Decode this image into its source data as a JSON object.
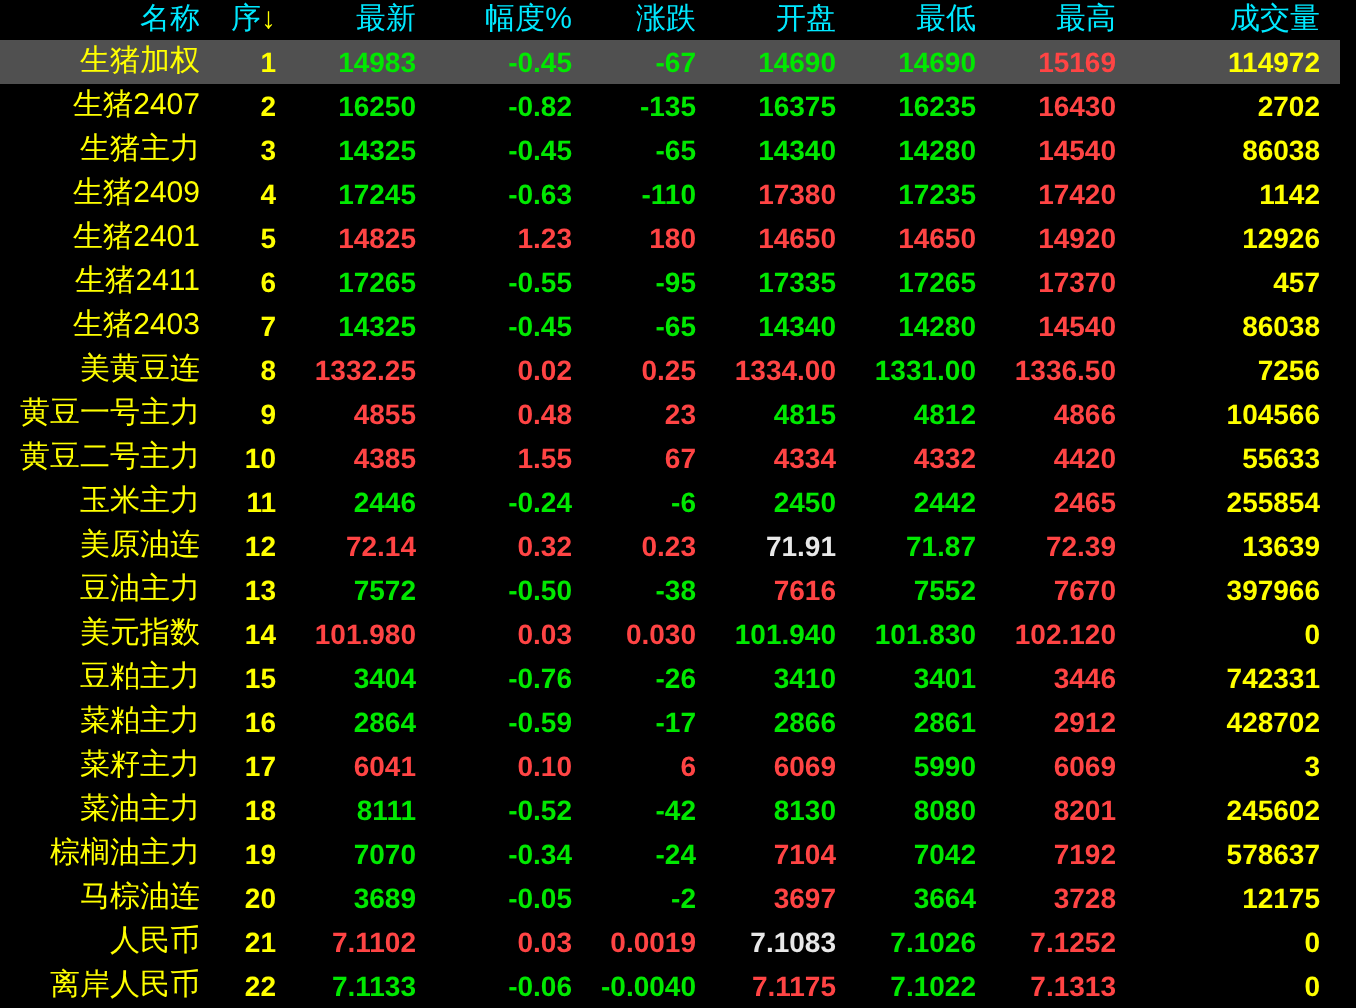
{
  "columns": [
    {
      "label": "名称"
    },
    {
      "label": "序",
      "sort_arrow": "↓"
    },
    {
      "label": "最新"
    },
    {
      "label": "幅度%"
    },
    {
      "label": "涨跌"
    },
    {
      "label": "开盘"
    },
    {
      "label": "最低"
    },
    {
      "label": "最高"
    },
    {
      "label": "成交量"
    }
  ],
  "rows": [
    {
      "name": "生猪加权",
      "index": "1",
      "selected": true,
      "cells": [
        {
          "text": "14983",
          "color": "#00e800"
        },
        {
          "text": "-0.45",
          "color": "#00e800"
        },
        {
          "text": "-67",
          "color": "#00e800"
        },
        {
          "text": "14690",
          "color": "#00e800"
        },
        {
          "text": "14690",
          "color": "#00e800"
        },
        {
          "text": "15169",
          "color": "#ff4444"
        }
      ],
      "volume": "114972"
    },
    {
      "name": "生猪2407",
      "index": "2",
      "selected": false,
      "cells": [
        {
          "text": "16250",
          "color": "#00e800"
        },
        {
          "text": "-0.82",
          "color": "#00e800"
        },
        {
          "text": "-135",
          "color": "#00e800"
        },
        {
          "text": "16375",
          "color": "#00e800"
        },
        {
          "text": "16235",
          "color": "#00e800"
        },
        {
          "text": "16430",
          "color": "#ff4444"
        }
      ],
      "volume": "2702"
    },
    {
      "name": "生猪主力",
      "index": "3",
      "selected": false,
      "cells": [
        {
          "text": "14325",
          "color": "#00e800"
        },
        {
          "text": "-0.45",
          "color": "#00e800"
        },
        {
          "text": "-65",
          "color": "#00e800"
        },
        {
          "text": "14340",
          "color": "#00e800"
        },
        {
          "text": "14280",
          "color": "#00e800"
        },
        {
          "text": "14540",
          "color": "#ff4444"
        }
      ],
      "volume": "86038"
    },
    {
      "name": "生猪2409",
      "index": "4",
      "selected": false,
      "cells": [
        {
          "text": "17245",
          "color": "#00e800"
        },
        {
          "text": "-0.63",
          "color": "#00e800"
        },
        {
          "text": "-110",
          "color": "#00e800"
        },
        {
          "text": "17380",
          "color": "#ff4444"
        },
        {
          "text": "17235",
          "color": "#00e800"
        },
        {
          "text": "17420",
          "color": "#ff4444"
        }
      ],
      "volume": "1142"
    },
    {
      "name": "生猪2401",
      "index": "5",
      "selected": false,
      "cells": [
        {
          "text": "14825",
          "color": "#ff4444"
        },
        {
          "text": "1.23",
          "color": "#ff4444"
        },
        {
          "text": "180",
          "color": "#ff4444"
        },
        {
          "text": "14650",
          "color": "#ff4444"
        },
        {
          "text": "14650",
          "color": "#ff4444"
        },
        {
          "text": "14920",
          "color": "#ff4444"
        }
      ],
      "volume": "12926"
    },
    {
      "name": "生猪2411",
      "index": "6",
      "selected": false,
      "cells": [
        {
          "text": "17265",
          "color": "#00e800"
        },
        {
          "text": "-0.55",
          "color": "#00e800"
        },
        {
          "text": "-95",
          "color": "#00e800"
        },
        {
          "text": "17335",
          "color": "#00e800"
        },
        {
          "text": "17265",
          "color": "#00e800"
        },
        {
          "text": "17370",
          "color": "#ff4444"
        }
      ],
      "volume": "457"
    },
    {
      "name": "生猪2403",
      "index": "7",
      "selected": false,
      "cells": [
        {
          "text": "14325",
          "color": "#00e800"
        },
        {
          "text": "-0.45",
          "color": "#00e800"
        },
        {
          "text": "-65",
          "color": "#00e800"
        },
        {
          "text": "14340",
          "color": "#00e800"
        },
        {
          "text": "14280",
          "color": "#00e800"
        },
        {
          "text": "14540",
          "color": "#ff4444"
        }
      ],
      "volume": "86038"
    },
    {
      "name": "美黄豆连",
      "index": "8",
      "selected": false,
      "cells": [
        {
          "text": "1332.25",
          "color": "#ff4444"
        },
        {
          "text": "0.02",
          "color": "#ff4444"
        },
        {
          "text": "0.25",
          "color": "#ff4444"
        },
        {
          "text": "1334.00",
          "color": "#ff4444"
        },
        {
          "text": "1331.00",
          "color": "#00e800"
        },
        {
          "text": "1336.50",
          "color": "#ff4444"
        }
      ],
      "volume": "7256"
    },
    {
      "name": "黄豆一号主力",
      "index": "9",
      "selected": false,
      "cells": [
        {
          "text": "4855",
          "color": "#ff4444"
        },
        {
          "text": "0.48",
          "color": "#ff4444"
        },
        {
          "text": "23",
          "color": "#ff4444"
        },
        {
          "text": "4815",
          "color": "#00e800"
        },
        {
          "text": "4812",
          "color": "#00e800"
        },
        {
          "text": "4866",
          "color": "#ff4444"
        }
      ],
      "volume": "104566"
    },
    {
      "name": "黄豆二号主力",
      "index": "10",
      "selected": false,
      "cells": [
        {
          "text": "4385",
          "color": "#ff4444"
        },
        {
          "text": "1.55",
          "color": "#ff4444"
        },
        {
          "text": "67",
          "color": "#ff4444"
        },
        {
          "text": "4334",
          "color": "#ff4444"
        },
        {
          "text": "4332",
          "color": "#ff4444"
        },
        {
          "text": "4420",
          "color": "#ff4444"
        }
      ],
      "volume": "55633"
    },
    {
      "name": "玉米主力",
      "index": "11",
      "selected": false,
      "cells": [
        {
          "text": "2446",
          "color": "#00e800"
        },
        {
          "text": "-0.24",
          "color": "#00e800"
        },
        {
          "text": "-6",
          "color": "#00e800"
        },
        {
          "text": "2450",
          "color": "#00e800"
        },
        {
          "text": "2442",
          "color": "#00e800"
        },
        {
          "text": "2465",
          "color": "#ff4444"
        }
      ],
      "volume": "255854"
    },
    {
      "name": "美原油连",
      "index": "12",
      "selected": false,
      "cells": [
        {
          "text": "72.14",
          "color": "#ff4444"
        },
        {
          "text": "0.32",
          "color": "#ff4444"
        },
        {
          "text": "0.23",
          "color": "#ff4444"
        },
        {
          "text": "71.91",
          "color": "#e8e8e8"
        },
        {
          "text": "71.87",
          "color": "#00e800"
        },
        {
          "text": "72.39",
          "color": "#ff4444"
        }
      ],
      "volume": "13639"
    },
    {
      "name": "豆油主力",
      "index": "13",
      "selected": false,
      "cells": [
        {
          "text": "7572",
          "color": "#00e800"
        },
        {
          "text": "-0.50",
          "color": "#00e800"
        },
        {
          "text": "-38",
          "color": "#00e800"
        },
        {
          "text": "7616",
          "color": "#ff4444"
        },
        {
          "text": "7552",
          "color": "#00e800"
        },
        {
          "text": "7670",
          "color": "#ff4444"
        }
      ],
      "volume": "397966"
    },
    {
      "name": "美元指数",
      "index": "14",
      "selected": false,
      "cells": [
        {
          "text": "101.980",
          "color": "#ff4444"
        },
        {
          "text": "0.03",
          "color": "#ff4444"
        },
        {
          "text": "0.030",
          "color": "#ff4444"
        },
        {
          "text": "101.940",
          "color": "#00e800"
        },
        {
          "text": "101.830",
          "color": "#00e800"
        },
        {
          "text": "102.120",
          "color": "#ff4444"
        }
      ],
      "volume": "0"
    },
    {
      "name": "豆粕主力",
      "index": "15",
      "selected": false,
      "cells": [
        {
          "text": "3404",
          "color": "#00e800"
        },
        {
          "text": "-0.76",
          "color": "#00e800"
        },
        {
          "text": "-26",
          "color": "#00e800"
        },
        {
          "text": "3410",
          "color": "#00e800"
        },
        {
          "text": "3401",
          "color": "#00e800"
        },
        {
          "text": "3446",
          "color": "#ff4444"
        }
      ],
      "volume": "742331"
    },
    {
      "name": "菜粕主力",
      "index": "16",
      "selected": false,
      "cells": [
        {
          "text": "2864",
          "color": "#00e800"
        },
        {
          "text": "-0.59",
          "color": "#00e800"
        },
        {
          "text": "-17",
          "color": "#00e800"
        },
        {
          "text": "2866",
          "color": "#00e800"
        },
        {
          "text": "2861",
          "color": "#00e800"
        },
        {
          "text": "2912",
          "color": "#ff4444"
        }
      ],
      "volume": "428702"
    },
    {
      "name": "菜籽主力",
      "index": "17",
      "selected": false,
      "cells": [
        {
          "text": "6041",
          "color": "#ff4444"
        },
        {
          "text": "0.10",
          "color": "#ff4444"
        },
        {
          "text": "6",
          "color": "#ff4444"
        },
        {
          "text": "6069",
          "color": "#ff4444"
        },
        {
          "text": "5990",
          "color": "#00e800"
        },
        {
          "text": "6069",
          "color": "#ff4444"
        }
      ],
      "volume": "3"
    },
    {
      "name": "菜油主力",
      "index": "18",
      "selected": false,
      "cells": [
        {
          "text": "8111",
          "color": "#00e800"
        },
        {
          "text": "-0.52",
          "color": "#00e800"
        },
        {
          "text": "-42",
          "color": "#00e800"
        },
        {
          "text": "8130",
          "color": "#00e800"
        },
        {
          "text": "8080",
          "color": "#00e800"
        },
        {
          "text": "8201",
          "color": "#ff4444"
        }
      ],
      "volume": "245602"
    },
    {
      "name": "棕榈油主力",
      "index": "19",
      "selected": false,
      "cells": [
        {
          "text": "7070",
          "color": "#00e800"
        },
        {
          "text": "-0.34",
          "color": "#00e800"
        },
        {
          "text": "-24",
          "color": "#00e800"
        },
        {
          "text": "7104",
          "color": "#ff4444"
        },
        {
          "text": "7042",
          "color": "#00e800"
        },
        {
          "text": "7192",
          "color": "#ff4444"
        }
      ],
      "volume": "578637"
    },
    {
      "name": "马棕油连",
      "index": "20",
      "selected": false,
      "cells": [
        {
          "text": "3689",
          "color": "#00e800"
        },
        {
          "text": "-0.05",
          "color": "#00e800"
        },
        {
          "text": "-2",
          "color": "#00e800"
        },
        {
          "text": "3697",
          "color": "#ff4444"
        },
        {
          "text": "3664",
          "color": "#00e800"
        },
        {
          "text": "3728",
          "color": "#ff4444"
        }
      ],
      "volume": "12175"
    },
    {
      "name": "人民币",
      "index": "21",
      "selected": false,
      "cells": [
        {
          "text": "7.1102",
          "color": "#ff4444"
        },
        {
          "text": "0.03",
          "color": "#ff4444"
        },
        {
          "text": "0.0019",
          "color": "#ff4444"
        },
        {
          "text": "7.1083",
          "color": "#e8e8e8"
        },
        {
          "text": "7.1026",
          "color": "#00e800"
        },
        {
          "text": "7.1252",
          "color": "#ff4444"
        }
      ],
      "volume": "0"
    },
    {
      "name": "离岸人民币",
      "index": "22",
      "selected": false,
      "cells": [
        {
          "text": "7.1133",
          "color": "#00e800"
        },
        {
          "text": "-0.06",
          "color": "#00e800"
        },
        {
          "text": "-0.0040",
          "color": "#00e800"
        },
        {
          "text": "7.1175",
          "color": "#ff4444"
        },
        {
          "text": "7.1022",
          "color": "#00e800"
        },
        {
          "text": "7.1313",
          "color": "#ff4444"
        }
      ],
      "volume": "0"
    }
  ]
}
